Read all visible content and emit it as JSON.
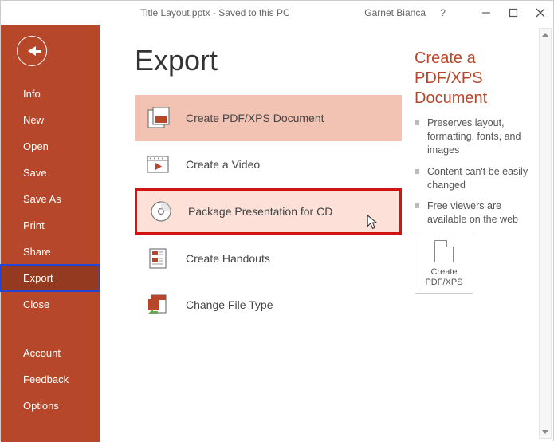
{
  "titlebar": {
    "file_title": "Title Layout.pptx  -  Saved to this PC",
    "user": "Garnet Bianca",
    "help": "?"
  },
  "sidebar": {
    "items": [
      {
        "label": "Info"
      },
      {
        "label": "New"
      },
      {
        "label": "Open"
      },
      {
        "label": "Save"
      },
      {
        "label": "Save As"
      },
      {
        "label": "Print"
      },
      {
        "label": "Share"
      },
      {
        "label": "Export"
      },
      {
        "label": "Close"
      },
      {
        "label": "Account"
      },
      {
        "label": "Feedback"
      },
      {
        "label": "Options"
      }
    ],
    "active_index": 7
  },
  "main": {
    "title": "Export",
    "options": [
      {
        "label": "Create PDF/XPS Document",
        "icon": "pdf-xps-icon"
      },
      {
        "label": "Create a Video",
        "icon": "video-icon"
      },
      {
        "label": "Package Presentation for CD",
        "icon": "cd-package-icon"
      },
      {
        "label": "Create Handouts",
        "icon": "handouts-icon"
      },
      {
        "label": "Change File Type",
        "icon": "change-type-icon"
      }
    ],
    "selected_index": 0,
    "highlight_index": 2
  },
  "info_panel": {
    "title": "Create a PDF/XPS Document",
    "bullets": [
      "Preserves layout, formatting, fonts, and images",
      "Content can't be easily changed",
      "Free viewers are available on the web"
    ],
    "button_label": "Create PDF/XPS"
  }
}
